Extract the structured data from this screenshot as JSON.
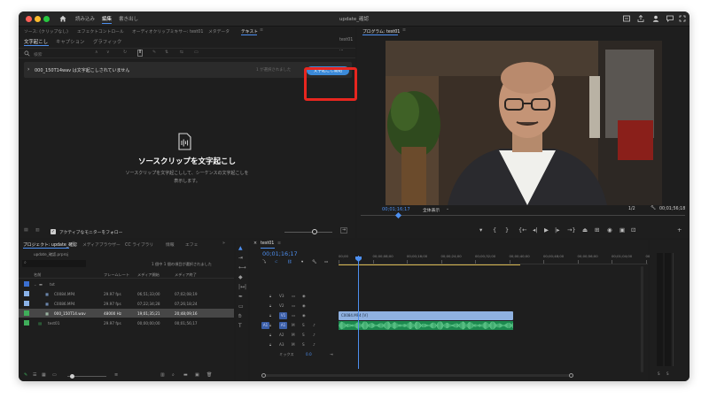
{
  "window": {
    "title": "update_確認"
  },
  "workspace_tabs": [
    "読み込み",
    "編集",
    "書き出し"
  ],
  "text_panel": {
    "tabs": [
      "ソース: (クリップなし)",
      "エフェクトコントロール",
      "オーディオクリップミキサー: test01",
      "メタデータ",
      "テキスト"
    ],
    "subtabs": [
      "文字起こし",
      "キャプション",
      "グラフィック"
    ],
    "sequence_label": "test01",
    "search_placeholder": "検索",
    "clip_message": "000_150T14wav は文字起こしされていません",
    "status_text": "1 が選択されました",
    "transcribe_button": "文字起こし開始",
    "empty_title": "ソースクリップを文字起こし",
    "empty_description": "ソースクリップを文字起こしして、シーケンスの文字起こしを表示します。",
    "follow_monitor_label": "アクティブなモニターをフォロー"
  },
  "program_monitor": {
    "title": "プログラム: test01",
    "timecode": "00;01;16;17",
    "fit_label": "全体表示",
    "resolution": "1/2",
    "duration": "00;01;56;18"
  },
  "project_panel": {
    "tabs": [
      "プロジェクト: update_確認",
      "メディアブラウザー",
      "CC ライブラリ",
      "情報",
      "エフェ"
    ],
    "project_file": "update_確認.prproj",
    "search_placeholder": "",
    "item_count": "1 個中 1 個の項目が選択されました",
    "columns": [
      "名前",
      "フレームレート",
      "メディア開始",
      "メディア終了"
    ],
    "rows": [
      {
        "name": "txt",
        "fps": "",
        "start": "",
        "end": ""
      },
      {
        "name": "C0084.MP4",
        "fps": "29.97 fps",
        "start": "06;51;33;00",
        "end": "07;02;08;19"
      },
      {
        "name": "C0086.MP4",
        "fps": "29.97 fps",
        "start": "07;22;34;28",
        "end": "07;26;18;24"
      },
      {
        "name": "000_150T14.wav",
        "fps": "48000 Hz",
        "start": "19;01;35;21",
        "end": "20;48;09;16"
      },
      {
        "name": "test01",
        "fps": "29.97 fps",
        "start": "00;00;00;00",
        "end": "00;01;56;17"
      }
    ]
  },
  "timeline": {
    "sequence_tab": "test01",
    "timecode": "00;01;16;17",
    "ruler_labels": [
      "00;00",
      "00;00;08;00",
      "00;00;16;00",
      "00;00;24;00",
      "00;00;32;00",
      "00;00;40;00",
      "00;00;48;00",
      "00;00;56;00",
      "00;01;04;00",
      "00;01;12;00"
    ],
    "video_tracks": [
      "V3",
      "V2",
      "V1"
    ],
    "audio_tracks": [
      "A1",
      "A2",
      "A3"
    ],
    "mix_label": "ミックス",
    "mix_value": "0.0",
    "video_clip_label": "C0084.MP4 [V]"
  },
  "audio_meter": {
    "labels": [
      "S",
      "S"
    ]
  }
}
